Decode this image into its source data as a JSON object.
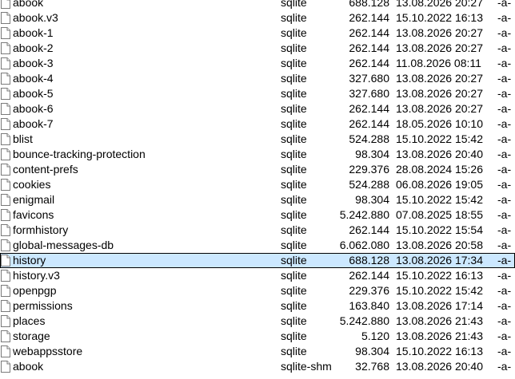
{
  "file_list": {
    "files": [
      {
        "name": "abook",
        "ext": "sqlite",
        "size": "688.128",
        "date": "13.08.2026 20:27",
        "attr": "-a-",
        "selected": false
      },
      {
        "name": "abook.v3",
        "ext": "sqlite",
        "size": "262.144",
        "date": "15.10.2022 16:13",
        "attr": "-a-",
        "selected": false
      },
      {
        "name": "abook-1",
        "ext": "sqlite",
        "size": "262.144",
        "date": "13.08.2026 20:27",
        "attr": "-a-",
        "selected": false
      },
      {
        "name": "abook-2",
        "ext": "sqlite",
        "size": "262.144",
        "date": "13.08.2026 20:27",
        "attr": "-a-",
        "selected": false
      },
      {
        "name": "abook-3",
        "ext": "sqlite",
        "size": "262.144",
        "date": "11.08.2026 08:11",
        "attr": "-a-",
        "selected": false
      },
      {
        "name": "abook-4",
        "ext": "sqlite",
        "size": "327.680",
        "date": "13.08.2026 20:27",
        "attr": "-a-",
        "selected": false
      },
      {
        "name": "abook-5",
        "ext": "sqlite",
        "size": "327.680",
        "date": "13.08.2026 20:27",
        "attr": "-a-",
        "selected": false
      },
      {
        "name": "abook-6",
        "ext": "sqlite",
        "size": "262.144",
        "date": "13.08.2026 20:27",
        "attr": "-a-",
        "selected": false
      },
      {
        "name": "abook-7",
        "ext": "sqlite",
        "size": "262.144",
        "date": "18.05.2026 10:10",
        "attr": "-a-",
        "selected": false
      },
      {
        "name": "blist",
        "ext": "sqlite",
        "size": "524.288",
        "date": "15.10.2022 15:42",
        "attr": "-a-",
        "selected": false
      },
      {
        "name": "bounce-tracking-protection",
        "ext": "sqlite",
        "size": "98.304",
        "date": "13.08.2026 20:40",
        "attr": "-a-",
        "selected": false
      },
      {
        "name": "content-prefs",
        "ext": "sqlite",
        "size": "229.376",
        "date": "28.08.2024 15:26",
        "attr": "-a-",
        "selected": false
      },
      {
        "name": "cookies",
        "ext": "sqlite",
        "size": "524.288",
        "date": "06.08.2026 19:05",
        "attr": "-a-",
        "selected": false
      },
      {
        "name": "enigmail",
        "ext": "sqlite",
        "size": "98.304",
        "date": "15.10.2022 15:42",
        "attr": "-a-",
        "selected": false
      },
      {
        "name": "favicons",
        "ext": "sqlite",
        "size": "5.242.880",
        "date": "07.08.2025 18:55",
        "attr": "-a-",
        "selected": false
      },
      {
        "name": "formhistory",
        "ext": "sqlite",
        "size": "262.144",
        "date": "15.10.2022 15:54",
        "attr": "-a-",
        "selected": false
      },
      {
        "name": "global-messages-db",
        "ext": "sqlite",
        "size": "6.062.080",
        "date": "13.08.2026 20:58",
        "attr": "-a-",
        "selected": false
      },
      {
        "name": "history",
        "ext": "sqlite",
        "size": "688.128",
        "date": "13.08.2026 17:34",
        "attr": "-a-",
        "selected": true
      },
      {
        "name": "history.v3",
        "ext": "sqlite",
        "size": "262.144",
        "date": "15.10.2022 16:13",
        "attr": "-a-",
        "selected": false
      },
      {
        "name": "openpgp",
        "ext": "sqlite",
        "size": "229.376",
        "date": "15.10.2022 15:42",
        "attr": "-a-",
        "selected": false
      },
      {
        "name": "permissions",
        "ext": "sqlite",
        "size": "163.840",
        "date": "13.08.2026 17:14",
        "attr": "-a-",
        "selected": false
      },
      {
        "name": "places",
        "ext": "sqlite",
        "size": "5.242.880",
        "date": "13.08.2026 21:43",
        "attr": "-a-",
        "selected": false
      },
      {
        "name": "storage",
        "ext": "sqlite",
        "size": "5.120",
        "date": "13.08.2026 21:43",
        "attr": "-a-",
        "selected": false
      },
      {
        "name": "webappsstore",
        "ext": "sqlite",
        "size": "98.304",
        "date": "15.10.2022 16:13",
        "attr": "-a-",
        "selected": false
      },
      {
        "name": "abook",
        "ext": "sqlite-shm",
        "size": "32.768",
        "date": "13.08.2026 20:40",
        "attr": "-a-",
        "selected": false
      }
    ]
  },
  "icons": {
    "file": "file-icon"
  },
  "colors": {
    "selected_background": "#cce8ff",
    "selected_border": "#000000",
    "text": "#000000",
    "background": "#ffffff"
  }
}
